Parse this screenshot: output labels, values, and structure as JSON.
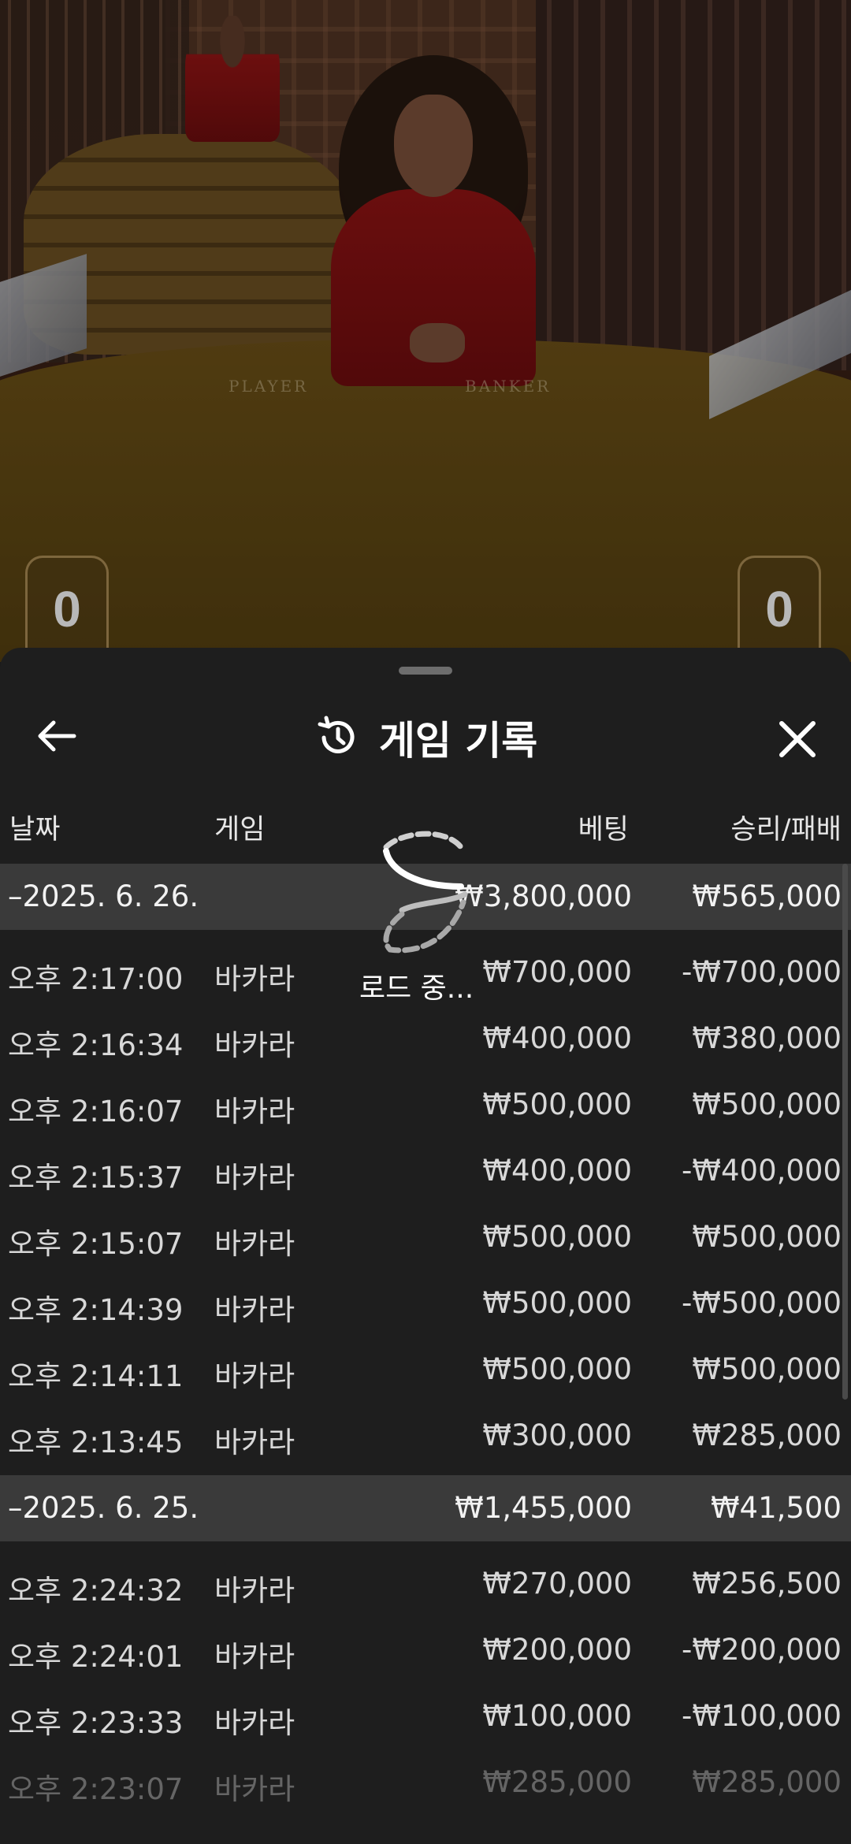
{
  "scene": {
    "table_labels": {
      "player": "PLAYER",
      "banker": "BANKER"
    },
    "score_left": "0",
    "score_right": "0"
  },
  "header": {
    "title": "게임 기록",
    "back_icon": "arrow-left-icon",
    "history_icon": "history-icon",
    "close_icon": "close-icon"
  },
  "columns": {
    "date": "날짜",
    "game": "게임",
    "bet": "베팅",
    "winloss": "승리/패배"
  },
  "groups": [
    {
      "date": "–2025. 6. 26.",
      "bet_total": "₩3,800,000",
      "win_total": "₩565,000",
      "rows": [
        {
          "time": "오후 2:17:00",
          "game": "바카라",
          "bet": "₩700,000",
          "win": "-₩700,000"
        },
        {
          "time": "오후 2:16:34",
          "game": "바카라",
          "bet": "₩400,000",
          "win": "₩380,000"
        },
        {
          "time": "오후 2:16:07",
          "game": "바카라",
          "bet": "₩500,000",
          "win": "₩500,000"
        },
        {
          "time": "오후 2:15:37",
          "game": "바카라",
          "bet": "₩400,000",
          "win": "-₩400,000"
        },
        {
          "time": "오후 2:15:07",
          "game": "바카라",
          "bet": "₩500,000",
          "win": "₩500,000"
        },
        {
          "time": "오후 2:14:39",
          "game": "바카라",
          "bet": "₩500,000",
          "win": "-₩500,000"
        },
        {
          "time": "오후 2:14:11",
          "game": "바카라",
          "bet": "₩500,000",
          "win": "₩500,000"
        },
        {
          "time": "오후 2:13:45",
          "game": "바카라",
          "bet": "₩300,000",
          "win": "₩285,000"
        }
      ]
    },
    {
      "date": "–2025. 6. 25.",
      "bet_total": "₩1,455,000",
      "win_total": "₩41,500",
      "rows": [
        {
          "time": "오후 2:24:32",
          "game": "바카라",
          "bet": "₩270,000",
          "win": "₩256,500"
        },
        {
          "time": "오후 2:24:01",
          "game": "바카라",
          "bet": "₩200,000",
          "win": "-₩200,000"
        },
        {
          "time": "오후 2:23:33",
          "game": "바카라",
          "bet": "₩100,000",
          "win": "-₩100,000"
        },
        {
          "time": "오후 2:23:07",
          "game": "바카라",
          "bet": "₩285,000",
          "win": "₩285,000"
        }
      ]
    }
  ],
  "loading": {
    "text": "로드 중...",
    "icon": "loading-spinner-icon"
  }
}
